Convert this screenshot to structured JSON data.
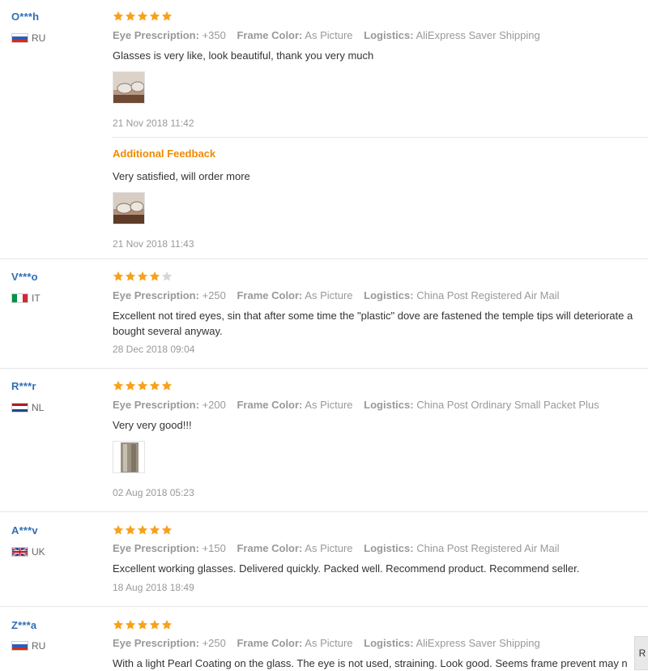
{
  "labels": {
    "prescription": "Eye Prescription:",
    "frame": "Frame Color:",
    "logistics": "Logistics:",
    "additional_feedback": "Additional Feedback"
  },
  "reviews": [
    {
      "user": "O***h",
      "country": "RU",
      "rating": 5,
      "prescription": "+350",
      "frame": "As Picture",
      "logistics": "AliExpress Saver Shipping",
      "text": "Glasses is very like, look beautiful, thank you very much",
      "date": "21 Nov 2018 11:42",
      "additional": {
        "text": "Very satisfied, will order more",
        "date": "21 Nov 2018 11:43"
      }
    },
    {
      "user": "V***o",
      "country": "IT",
      "rating": 4,
      "prescription": "+250",
      "frame": "As Picture",
      "logistics": "China Post Registered Air Mail",
      "text_line1": "Excellent not tired eyes, sin that after some time the \"plastic\" dove are fastened the temple tips will deteriorate a",
      "text_line2": "bought several anyway.",
      "date": "28 Dec 2018 09:04"
    },
    {
      "user": "R***r",
      "country": "NL",
      "rating": 5,
      "prescription": "+200",
      "frame": "As Picture",
      "logistics": "China Post Ordinary Small Packet Plus",
      "text": "Very very good!!!",
      "date": "02 Aug 2018 05:23"
    },
    {
      "user": "A***v",
      "country": "UK",
      "rating": 5,
      "prescription": "+150",
      "frame": "As Picture",
      "logistics": "China Post Registered Air Mail",
      "text": "Excellent working glasses. Delivered quickly. Packed well. Recommend product. Recommend seller.",
      "date": "18 Aug 2018 18:49"
    },
    {
      "user": "Z***a",
      "country": "RU",
      "rating": 5,
      "prescription": "+250",
      "frame": "As Picture",
      "logistics": "AliExpress Saver Shipping",
      "text": "With a light Pearl Coating on the glass. The eye is not used, straining. Look good. Seems frame prevent may n"
    }
  ],
  "edge_button": "R",
  "colors": {
    "star": "#f7a21b",
    "star_empty": "#d6d6d6",
    "username": "#2f6fb4",
    "additional_feedback": "#f08a00"
  }
}
